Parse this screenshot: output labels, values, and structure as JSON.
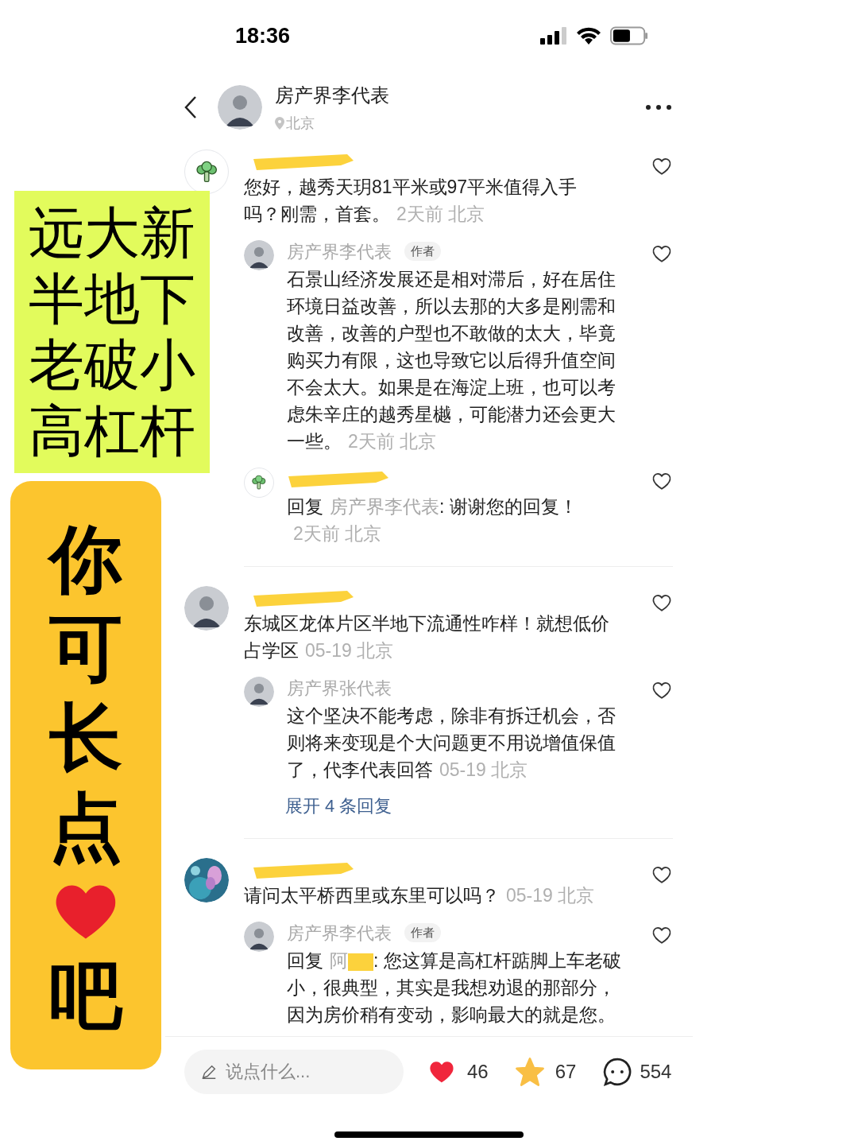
{
  "status_bar": {
    "time": "18:36"
  },
  "header": {
    "name": "房产界李代表",
    "location": "北京"
  },
  "comments": [
    {
      "avatar": {
        "kind": "broccoli"
      },
      "redacted": true,
      "text": "您好，越秀天玥81平米或97平米值得入手吗？刚需，首套。",
      "meta": "2天前 北京",
      "liked": false,
      "replies": [
        {
          "avatar": {
            "kind": "person"
          },
          "name": "房产界李代表",
          "badge": "作者",
          "text": "石景山经济发展还是相对滞后，好在居住环境日益改善，所以去那的大多是刚需和改善，改善的户型也不敢做的太大，毕竟购买力有限，这也导致它以后得升值空间不会太大。如果是在海淀上班，也可以考虑朱辛庄的越秀星樾，可能潜力还会更大一些。",
          "meta": "2天前 北京",
          "liked": false
        },
        {
          "avatar": {
            "kind": "broccoli"
          },
          "redacted": true,
          "reply_label": "回复",
          "reply_to": "房产界李代表",
          "text": ": 谢谢您的回复！",
          "meta": "2天前 北京",
          "liked": false
        }
      ]
    },
    {
      "avatar": {
        "kind": "person"
      },
      "redacted": true,
      "text": "东城区龙体片区半地下流通性咋样！就想低价占学区",
      "meta": "05-19 北京",
      "liked": false,
      "replies": [
        {
          "avatar": {
            "kind": "person"
          },
          "name": "房产界张代表",
          "text": "这个坚决不能考虑，除非有拆迁机会，否则将来变现是个大问题更不用说增值保值了，代李代表回答",
          "meta": "05-19 北京",
          "liked": false
        }
      ],
      "expand": "展开 4 条回复"
    },
    {
      "avatar": {
        "kind": "picture"
      },
      "redacted": true,
      "text": "请问太平桥西里或东里可以吗？",
      "meta": "05-19 北京",
      "liked": false,
      "replies": [
        {
          "avatar": {
            "kind": "person"
          },
          "name": "房产界李代表",
          "badge": "作者",
          "reply_label": "回复",
          "reply_to": "阿",
          "reply_to_redacted": true,
          "text": ": 您这算是高杠杆踮脚上车老破小，很典型，其实是我想劝退的那部分，因为房价稍有变动，影响最大的就是您。",
          "liked": false
        }
      ]
    }
  ],
  "bottom_bar": {
    "placeholder": "说点什么...",
    "likes": "46",
    "liked": true,
    "favorites": "67",
    "favorited": true,
    "comments": "554"
  },
  "overlay": {
    "banner_lines": [
      "远大新",
      "半地下",
      "老破小",
      "高杠杆"
    ],
    "vertical_text": "你可长点",
    "vertical_end": "吧"
  }
}
